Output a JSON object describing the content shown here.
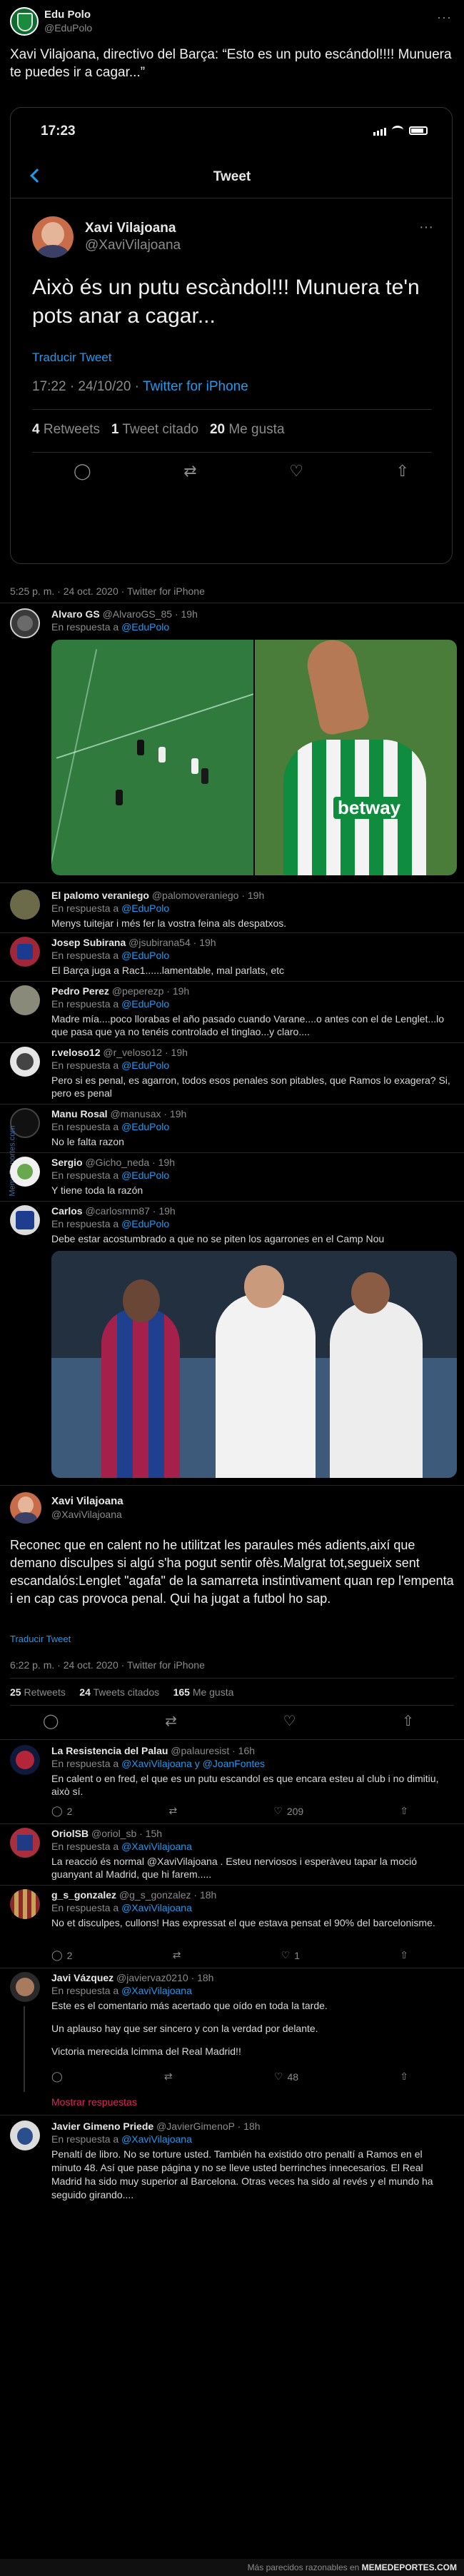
{
  "main": {
    "author_name": "Edu Polo",
    "author_handle": "@EduPolo",
    "text": "Xavi Vilajoana, directivo del Barça: “Esto es un puto escándol!!!! Munuera te puedes ir a cagar...”",
    "meta": "5:25 p. m. · 24 oct. 2020 · Twitter for iPhone"
  },
  "phone": {
    "time": "17:23",
    "title": "Tweet",
    "name": "Xavi Vilajoana",
    "handle": "@XaviVilajoana",
    "text": "Això és un putu escàndol!!! Munuera te'n pots anar a cagar...",
    "translate": "Traducir Tweet",
    "time_date": "17:22 · 24/10/20 · ",
    "source": "Twitter for iPhone",
    "rt_count": "4",
    "rt_label": "Retweets",
    "qt_count": "1",
    "qt_label": "Tweet citado",
    "likes_count": "20",
    "likes_label": "Me gusta"
  },
  "replies": [
    {
      "name": "Alvaro GS",
      "handle": "@AlvaroGS_85 · 19h",
      "reply_to": "En respuesta a",
      "mention": "@EduPolo",
      "text": ""
    },
    {
      "name": "El palomo veraniego",
      "handle": "@palomoveraniego · 19h",
      "reply_to": "En respuesta a",
      "mention": "@EduPolo",
      "text": "Menys tuitejar i més fer la vostra feina als despatxos."
    },
    {
      "name": "Josep Subirana",
      "handle": "@jsubirana54 · 19h",
      "reply_to": "En respuesta a",
      "mention": "@EduPolo",
      "text": "El Barça juga a Rac1......lamentable, mal parlats, etc"
    },
    {
      "name": "Pedro Perez",
      "handle": "@peperezp · 19h",
      "reply_to": "En respuesta a",
      "mention": "@EduPolo",
      "text": "Madre mía....poco llorabas el año pasado cuando Varane....o antes con el de Lenglet...lo que pasa que ya no tenéis controlado el tinglao...y claro...."
    },
    {
      "name": "r.veloso12",
      "handle": "@r_veloso12 · 19h",
      "reply_to": "En respuesta a",
      "mention": "@EduPolo",
      "text": "Pero si es penal, es agarron, todos esos penales son pitables, que Ramos lo exagera? Si, pero es penal"
    },
    {
      "name": "Manu Rosal",
      "handle": "@manusax · 19h",
      "reply_to": "En respuesta a",
      "mention": "@EduPolo",
      "text": "No le falta razon"
    },
    {
      "name": "Sergio",
      "handle": "@Gicho_neda · 19h",
      "reply_to": "En respuesta a",
      "mention": "@EduPolo",
      "text": "Y tiene toda la razón"
    },
    {
      "name": "Carlos",
      "handle": "@carlosmm87 · 19h",
      "reply_to": "En respuesta a",
      "mention": "@EduPolo",
      "text": "Debe estar acostumbrado a que no se piten los agarrones en el Camp Nou"
    }
  ],
  "xavi": {
    "name": "Xavi Vilajoana",
    "handle": "@XaviVilajoana",
    "text": "Reconec que en calent no he utilitzat les paraules més adients,així que demano disculpes si algú s'ha pogut sentir ofès.Malgrat tot,segueix sent escandalós:Lenglet \"agafa\" de la samarreta instintivament quan rep l'empenta i en cap cas provoca penal. Qui ha jugat a futbol ho sap.",
    "translate": "Traducir Tweet",
    "meta": "6:22 p. m. · 24 oct. 2020 · Twitter for iPhone",
    "rt_count": "25",
    "rt_label": "Retweets",
    "qt_count": "24",
    "qt_label": "Tweets citados",
    "likes_count": "165",
    "likes_label": "Me gusta"
  },
  "replies2": [
    {
      "name": "La Resistencia del Palau",
      "handle": "@palauresist · 16h",
      "reply_to": "En respuesta a",
      "mention": "@XaviVilajoana y @JoanFontes",
      "text": "En calent o en fred, el que es un putu escandol es que encara esteu al club i no dimitiu, això sí.",
      "c": "2",
      "l": "209"
    },
    {
      "name": "OriolSB",
      "handle": "@oriol_sb · 15h",
      "reply_to": "En respuesta a",
      "mention": "@XaviVilajoana",
      "text": "La reacció és normal @XaviVilajoana . Esteu nerviosos i esperàveu tapar la moció guanyant al Madrid, que hi farem.....",
      "c": "",
      "l": ""
    },
    {
      "name": "g_s_gonzalez",
      "handle": "@g_s_gonzalez · 18h",
      "reply_to": "En respuesta a",
      "mention": "@XaviVilajoana",
      "text": "No et disculpes, cullons! Has expressat el que estava pensat el 90% del barcelonisme.",
      "c": "2",
      "l": "1"
    },
    {
      "name": "Javi Vázquez",
      "handle": "@javiervaz0210 · 18h",
      "reply_to": "En respuesta a",
      "mention": "@XaviVilajoana",
      "text": "Este es el comentario más acertado que oído en toda la tarde.",
      "text2": "Un aplauso hay que ser sincero y con la verdad por delante.",
      "text3": "Victoria merecida lcimma del Real Madrid!!",
      "c": "",
      "l": "48"
    },
    {
      "name": "Javier Gimeno Priede",
      "handle": "@JavierGimenoP · 18h",
      "reply_to": "En respuesta a",
      "mention": "@XaviVilajoana",
      "text": "Penaltí de libro. No se torture usted. También ha existido otro penaltí a Ramos en el minuto 48. Así que pase página y no se lleve usted berrinches innecesarios. El Real Madrid ha sido muy superior al Barcelona. Otras veces ha sido al revés y el mundo ha seguido girando....",
      "c": "",
      "l": ""
    }
  ],
  "show_replies": "Mostrar respuestas",
  "footer": "Más parecidos razonables en ",
  "footer_brand": "MEMEDEPORTES.COM",
  "watermark": "MemeDeportes.com",
  "image_text": "betway",
  "colors": {
    "accent": "#1d9bf0",
    "pitch": "#2f7a3c",
    "betis_green": "#0f8c3d"
  }
}
